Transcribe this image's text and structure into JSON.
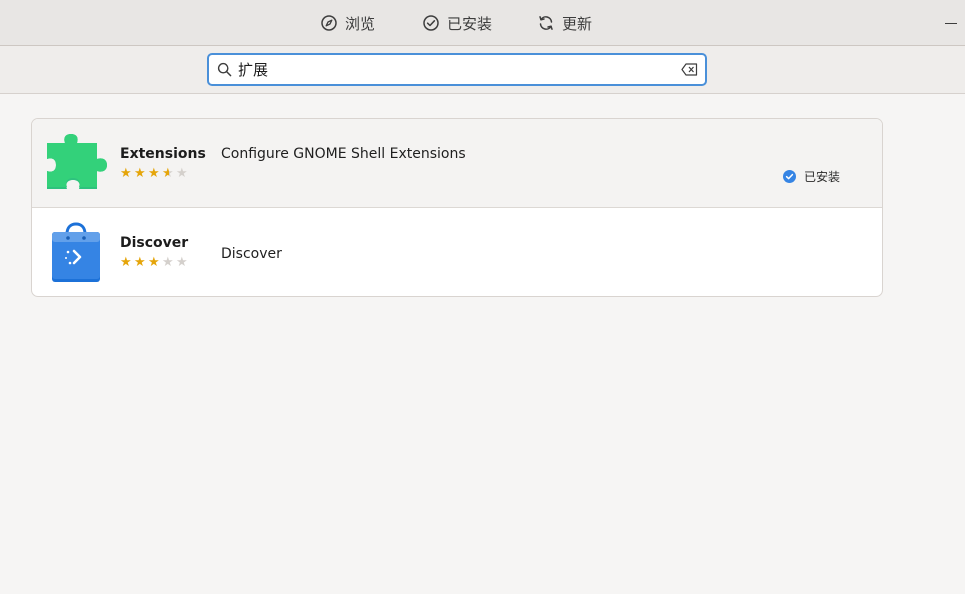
{
  "header": {
    "tabs": [
      {
        "label": "浏览",
        "icon": "compass-icon"
      },
      {
        "label": "已安装",
        "icon": "check-circle-icon"
      },
      {
        "label": "更新",
        "icon": "refresh-icon"
      }
    ]
  },
  "search": {
    "value": "扩展",
    "placeholder": ""
  },
  "results": [
    {
      "name": "Extensions",
      "summary": "Configure GNOME Shell Extensions",
      "rating": 3.5,
      "rating_max": 5,
      "icon": "puzzle-piece-icon",
      "installed": true,
      "installed_label": "已安装"
    },
    {
      "name": "Discover",
      "summary": "Discover",
      "rating": 3,
      "rating_max": 5,
      "icon": "shopping-bag-icon",
      "installed": false
    }
  ],
  "colors": {
    "accent": "#4a90d9",
    "star": "#e5a50a",
    "puzzle": "#33d17a",
    "bag": "#3584e4"
  }
}
